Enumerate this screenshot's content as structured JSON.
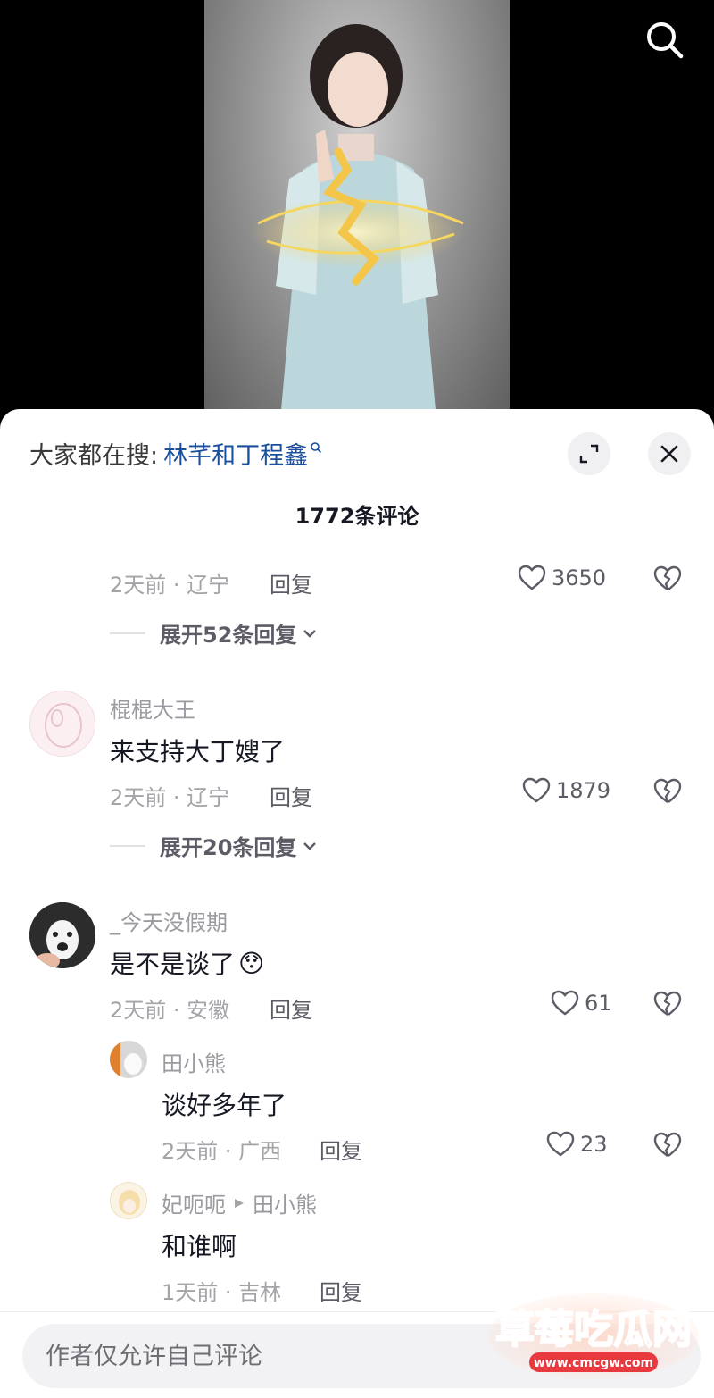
{
  "search_hint": {
    "prefix": "大家都在搜:",
    "keyword": "林芊和丁程鑫"
  },
  "comment_count": "1772条评论",
  "comments": [
    {
      "meta": "2天前 · 辽宁",
      "reply": "回复",
      "likes": "3650",
      "expand": "展开52条回复"
    },
    {
      "username": "棍棍大王",
      "text": "来支持大丁嫂了",
      "meta": "2天前 · 辽宁",
      "reply": "回复",
      "likes": "1879",
      "expand": "展开20条回复"
    },
    {
      "username": "_今天没假期",
      "text": "是不是谈了",
      "emoji": "😯",
      "meta": "2天前 · 安徽",
      "reply": "回复",
      "likes": "61",
      "replies": [
        {
          "username": "田小熊",
          "text": "谈好多年了",
          "meta": "2天前 · 广西",
          "reply": "回复",
          "likes": "23"
        },
        {
          "username": "妃呃呃",
          "reply_to": "田小熊",
          "text": "和谁啊",
          "meta": "1天前 · 吉林",
          "reply": "回复"
        }
      ]
    }
  ],
  "input": {
    "placeholder": "作者仅允许自己评论"
  },
  "watermark": {
    "title": "草莓吃瓜网",
    "url": "www.cmcgw.com"
  },
  "colors": {
    "keyword": "#1a4f9c",
    "watermark": "#e8393f"
  },
  "icons": {
    "search": "search-icon",
    "expand": "expand-icon",
    "close": "close-icon",
    "like": "heart-icon",
    "dislike": "broken-heart-icon"
  }
}
